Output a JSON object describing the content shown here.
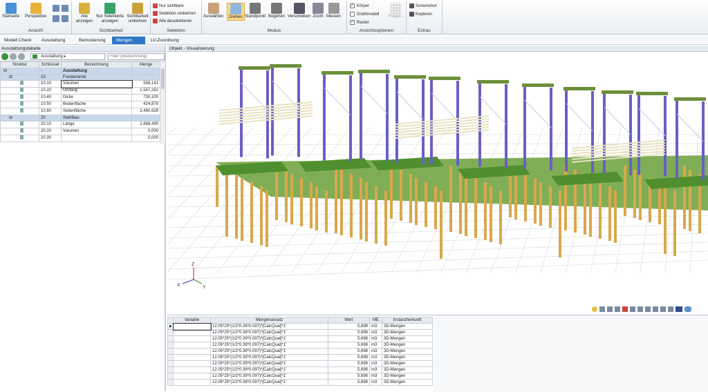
{
  "ribbon": {
    "ansicht": {
      "label": "Ansicht",
      "startseite": "Startseite",
      "perspektive": "Perspektive"
    },
    "sichtbarkeit": {
      "label": "Sichtbarkeit",
      "alle": "Alle anzeigen",
      "nur_selektierte": "Nur Selektierte anzeigen",
      "sichtbarkeit_umkehren": "Sichtbarkeit umkehren"
    },
    "selektion": {
      "label": "Selektion",
      "nur_sichtbare": "Nur sichtbare",
      "selektion_umkehren": "Selektion umkehren",
      "alle_deselektieren": "Alle deselektieren"
    },
    "modus": {
      "label": "Modus",
      "items": [
        "Auswählen",
        "Drehen",
        "Standpunkt",
        "Begehen",
        "Verschieben",
        "Zoom",
        "Messen"
      ]
    },
    "ansichtsoptionen": {
      "label": "Ansichtsoptionen",
      "koerper": "Körper",
      "drahtmodell": "Drahtmodell",
      "raster": "Raster",
      "projekt": "Projekt..."
    },
    "extras": {
      "label": "Extras",
      "screenshot": "Screenshot",
      "kopieren": "Kopieren"
    }
  },
  "tabs": [
    "Modell Check",
    "Ausstattung",
    "Bemusterung",
    "Mengen",
    "LV-Zuordnung"
  ],
  "left": {
    "title": "Ausstattungstabelle",
    "path": "Ausstattung",
    "filter_placeholder": "Filter (Bezeichnung)",
    "headers": [
      "Struktur",
      "Schlüssel",
      "Bezeichnung",
      "Menge"
    ],
    "rows": [
      {
        "key": "-",
        "name": "Ausstattung",
        "qty": "",
        "type": "root"
      },
      {
        "key": "10",
        "name": "Fundamente",
        "qty": "",
        "type": "group"
      },
      {
        "key": "10.10",
        "name": "Volumen",
        "qty": "558,141",
        "type": "item"
      },
      {
        "key": "10.20",
        "name": "Umfang",
        "qty": "1.567,262",
        "type": "item"
      },
      {
        "key": "10.40",
        "name": "Dicke",
        "qty": "730,100",
        "type": "item"
      },
      {
        "key": "10.50",
        "name": "Bodenfläche",
        "qty": "424,879",
        "type": "item"
      },
      {
        "key": "10.60",
        "name": "Seitenfläche",
        "qty": "2.480,628",
        "type": "item"
      },
      {
        "key": "20",
        "name": "Stahlbau",
        "qty": "",
        "type": "group"
      },
      {
        "key": "20.10",
        "name": "Länge",
        "qty": "2.888,490",
        "type": "item"
      },
      {
        "key": "20.20",
        "name": "Volumen",
        "qty": "0,000",
        "type": "item"
      },
      {
        "key": "20.30",
        "name": "",
        "qty": "0,000",
        "type": "item"
      }
    ]
  },
  "viewport": {
    "title": "Objekt - Visualisierung",
    "axes": {
      "x": "X",
      "y": "Y",
      "z": "Z"
    }
  },
  "bottom": {
    "headers": [
      "Variable",
      "Mengenansatz",
      "Wert",
      "ME",
      "Instanzherkunft"
    ],
    "rows": [
      {
        "formula": "12.05*25*(1/2*0.39*0.097)*[CalcQual]*1'",
        "value": "5,698",
        "unit": "m3",
        "origin": "3D-Mengen"
      },
      {
        "formula": "12.05*25*(1/2*0.39*0.097)*[CalcQual]*1'",
        "value": "5,698",
        "unit": "m3",
        "origin": "3D-Mengen"
      },
      {
        "formula": "12.05*25*(1/2*0.39*0.097)*[CalcQual]*1'",
        "value": "5,698",
        "unit": "m3",
        "origin": "3D-Mengen"
      },
      {
        "formula": "12.05*25*(1/2*0.39*0.097)*[CalcQual]*1'",
        "value": "5,698",
        "unit": "m3",
        "origin": "3D-Mengen"
      },
      {
        "formula": "12.05*25*(1/2*0.39*0.097)*[CalcQual]*1'",
        "value": "5,698",
        "unit": "m3",
        "origin": "3D-Mengen"
      },
      {
        "formula": "12.05*25*(1/2*0.39*0.097)*[CalcQual]*1'",
        "value": "5,698",
        "unit": "m3",
        "origin": "3D-Mengen"
      },
      {
        "formula": "12.05*25*(1/2*0.39*0.097)*[CalcQual]*1'",
        "value": "5,698",
        "unit": "m3",
        "origin": "3D-Mengen"
      },
      {
        "formula": "12.05*25*(1/2*0.39*0.097)*[CalcQual]*1'",
        "value": "5,698",
        "unit": "m3",
        "origin": "3D-Mengen"
      },
      {
        "formula": "12.05*25*(1/2*0.39*0.097)*[CalcQual]*1'",
        "value": "5,698",
        "unit": "m3",
        "origin": "3D-Mengen"
      },
      {
        "formula": "12.05*25*(1/2*0.39*0.097)*[CalcQual]*1'",
        "value": "5,698",
        "unit": "m3",
        "origin": "3D-Mengen"
      }
    ]
  },
  "colors": {
    "accent": "#2e78c7",
    "steel": "#6a5fc4",
    "pile": "#d9a84a",
    "foundation": "#4f8f2e"
  }
}
